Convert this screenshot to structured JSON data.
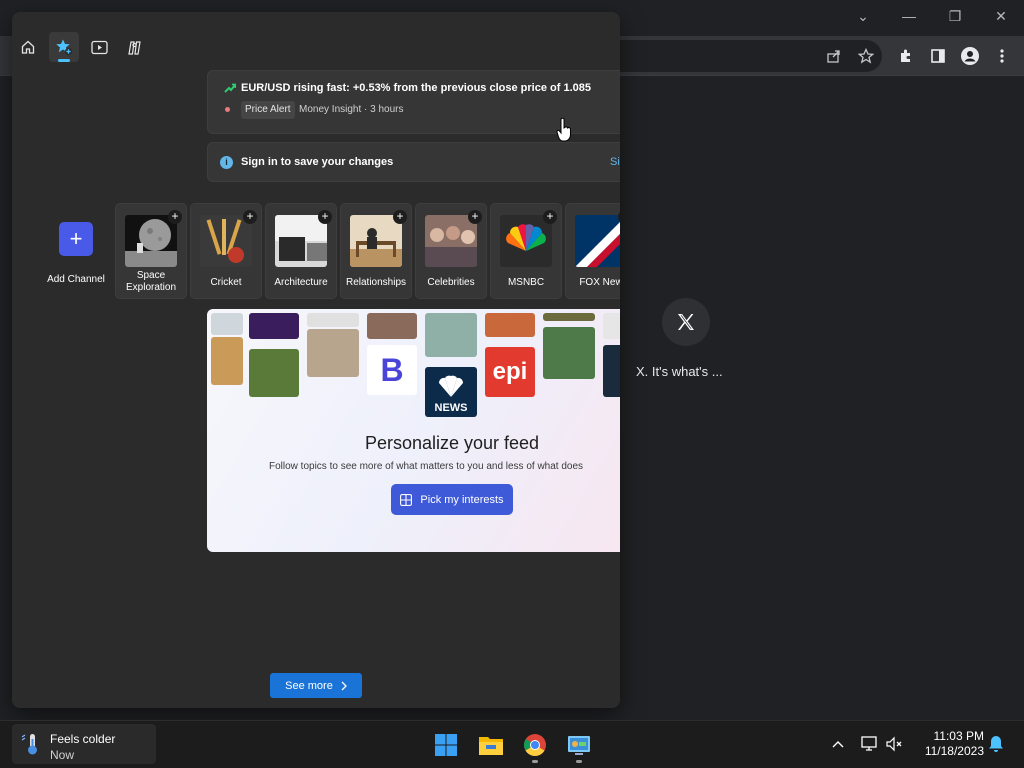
{
  "browser": {
    "window_controls": {
      "minimize": "—",
      "restore": "❐",
      "close": "✕",
      "tab_search": "⌄"
    },
    "toolbar_icons": [
      "share-icon",
      "star-icon",
      "extensions-icon",
      "side-panel-icon",
      "profile-icon",
      "menu-icon"
    ],
    "shortcut": {
      "label": "X. It's what's ..."
    }
  },
  "widgets": {
    "nav": [
      "home-icon",
      "following-icon",
      "watch-icon",
      "play-icon"
    ],
    "alert": {
      "title": "EUR/USD rising fast: +0.53% from the previous close price of 1.085",
      "badge": "Price Alert",
      "source": "Money Insight · 3 hours"
    },
    "signin": {
      "text": "Sign in to save your changes",
      "link": "Si"
    },
    "add_channel": {
      "icon": "+",
      "label": "Add Channel"
    },
    "channels": [
      {
        "label": "Space Exploration"
      },
      {
        "label": "Cricket"
      },
      {
        "label": "Architecture"
      },
      {
        "label": "Relationships"
      },
      {
        "label": "Celebrities"
      },
      {
        "label": "MSNBC"
      },
      {
        "label": "FOX New"
      }
    ],
    "personalize": {
      "title": "Personalize your feed",
      "subtitle": "Follow topics to see more of what matters to you and less of what does",
      "button": "Pick my interests",
      "logo_b": "B",
      "logo_news": "NEWS",
      "logo_epi": "epi"
    },
    "see_more": "See more"
  },
  "taskbar": {
    "weather": {
      "title": "Feels colder",
      "subtitle": "Now"
    },
    "apps": [
      "start-icon",
      "file-explorer-icon",
      "chrome-icon",
      "control-panel-icon"
    ],
    "time": "11:03 PM",
    "date": "11/18/2023"
  },
  "colors": {
    "panel": "#2b2b2b",
    "accent_blue": "#3f5ad8",
    "see_more_blue": "#1a73d6",
    "nav_indicator": "#4cc2ff"
  }
}
